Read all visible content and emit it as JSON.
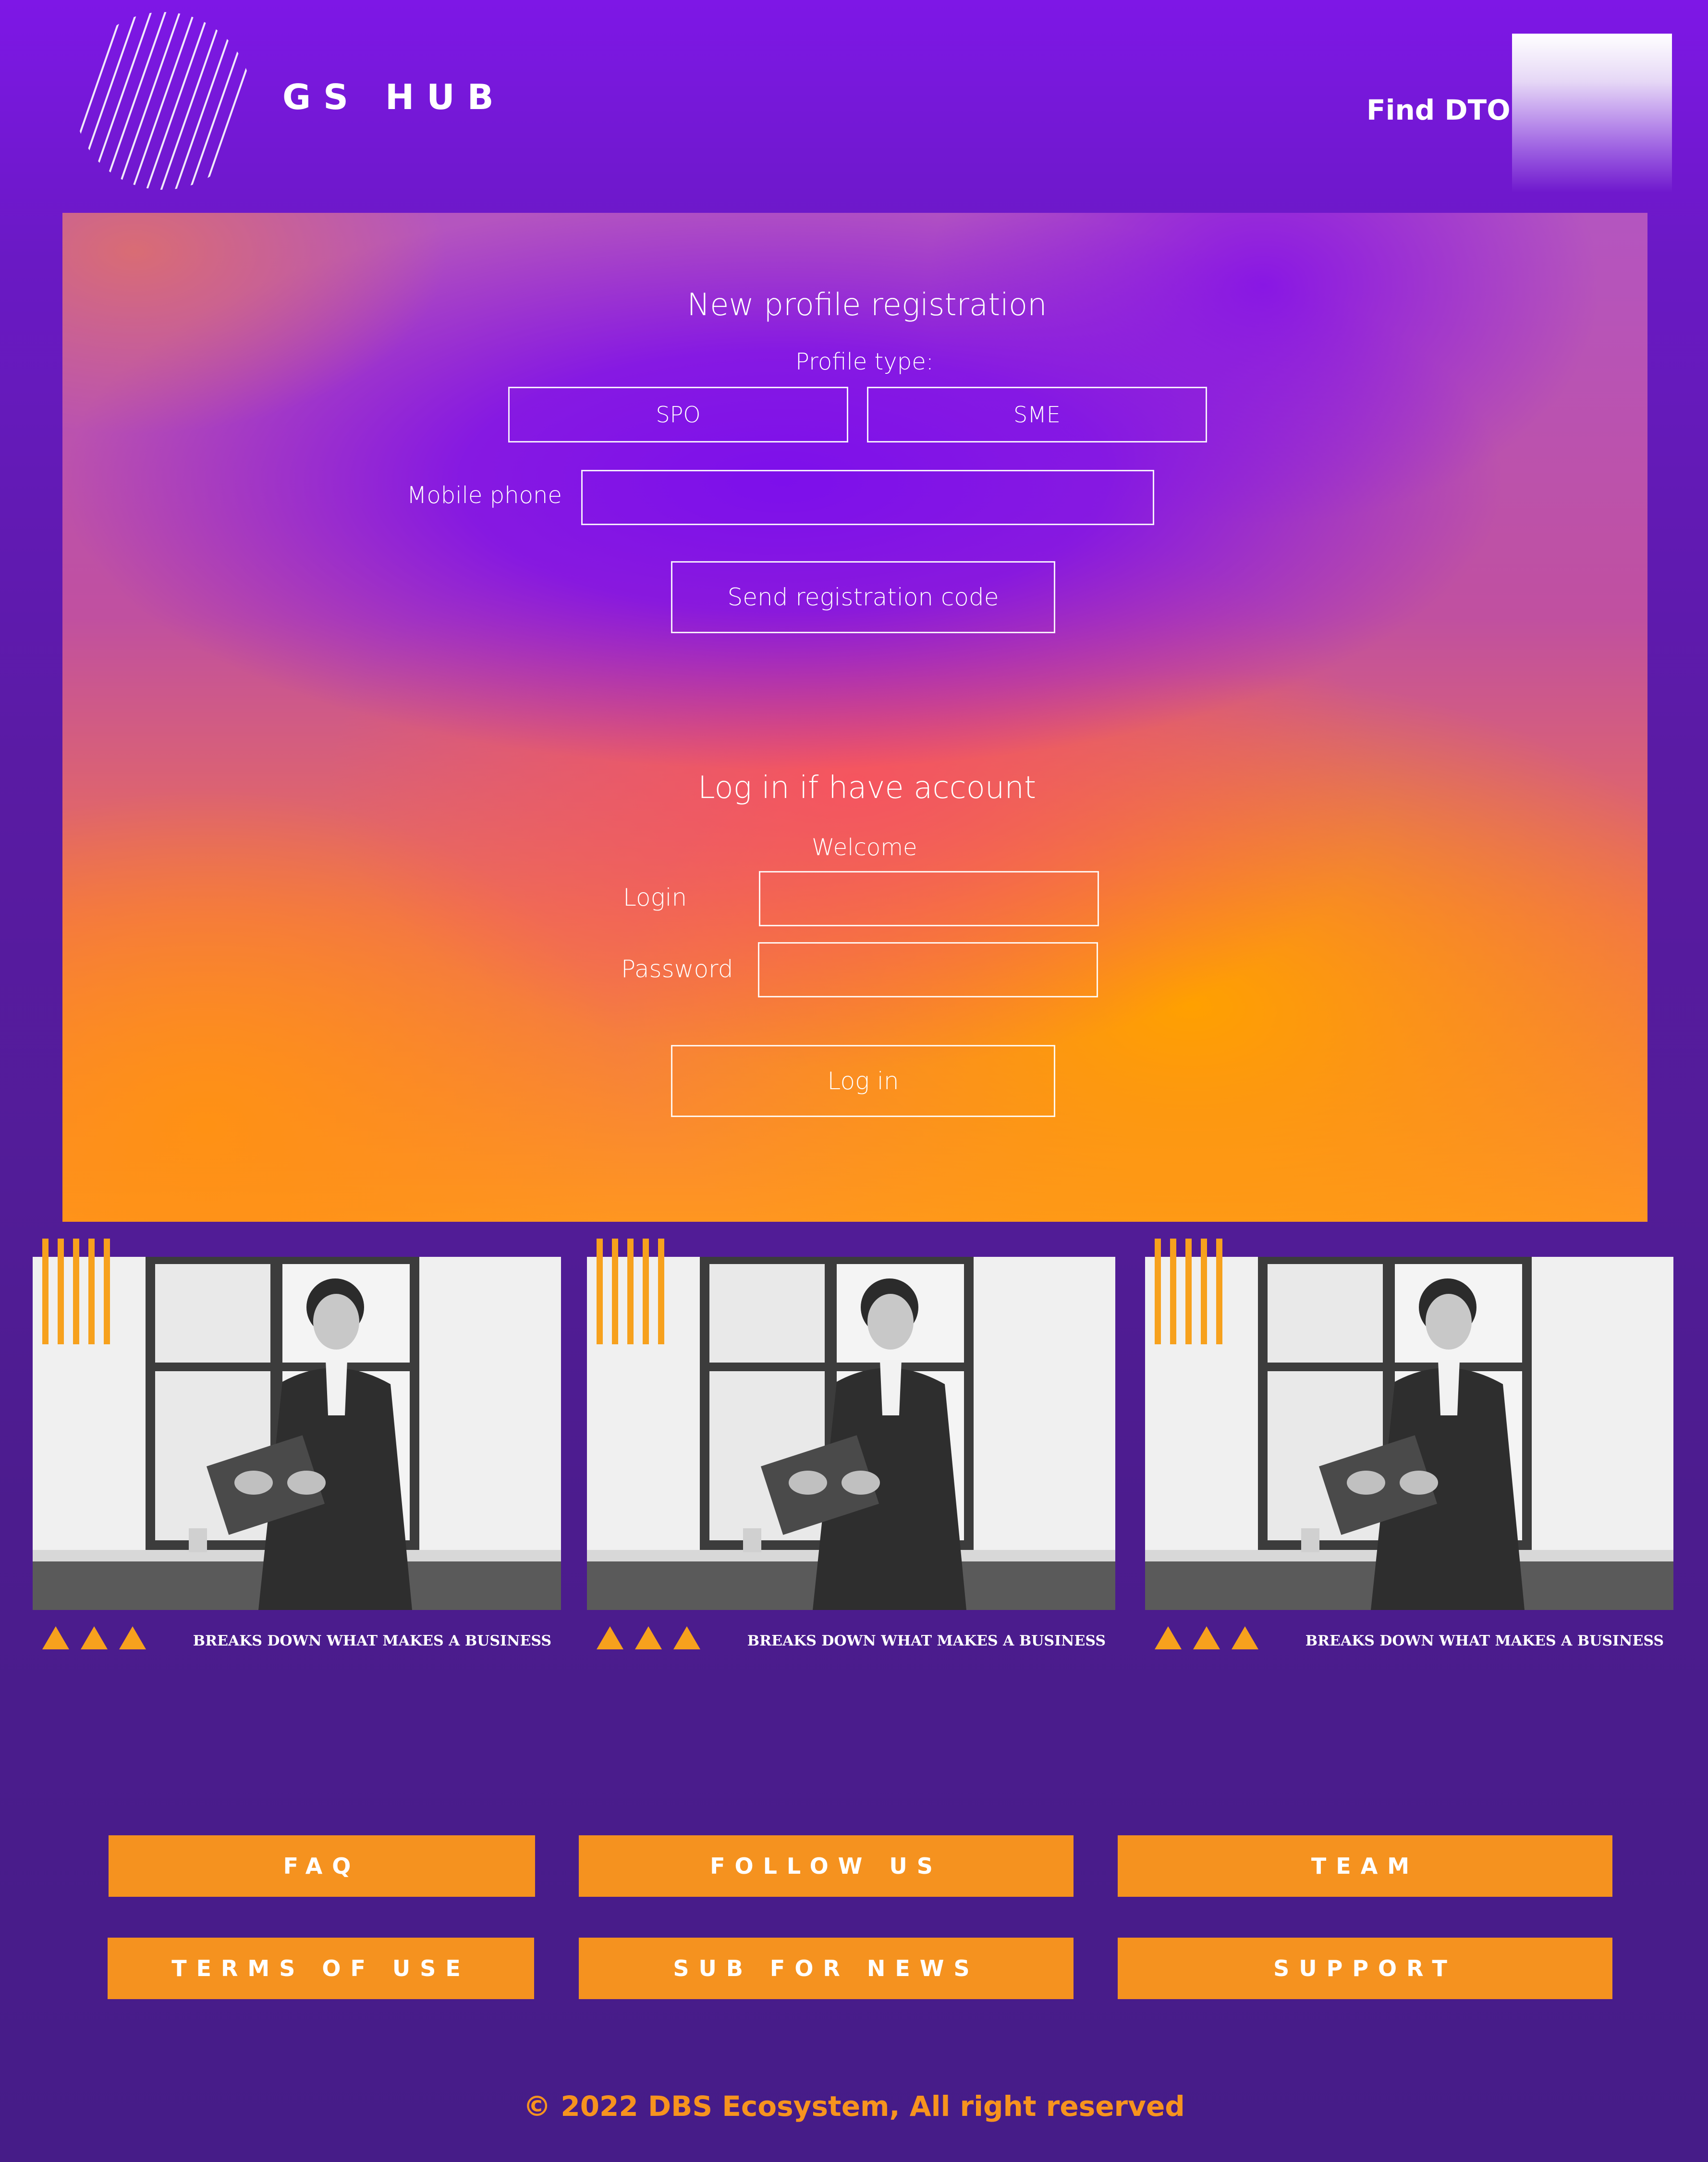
{
  "header": {
    "brand": "GS HUB",
    "nav_find_dto": "Find DTO"
  },
  "registration": {
    "title": "New profile registration",
    "profile_type_label": "Profile type:",
    "profile_types": [
      "SPO",
      "SME"
    ],
    "mobile_phone_label": "Mobile phone",
    "mobile_phone_value": "",
    "send_code_label": "Send registration code"
  },
  "login": {
    "title": "Log in if have account",
    "welcome": "Welcome",
    "login_label": "Login",
    "login_value": "",
    "password_label": "Password",
    "password_value": "",
    "submit_label": "Log in"
  },
  "cards": [
    {
      "caption": "BREAKS DOWN WHAT MAKES A BUSINESS"
    },
    {
      "caption": "BREAKS DOWN WHAT MAKES A BUSINESS"
    },
    {
      "caption": "BREAKS DOWN WHAT MAKES A BUSINESS"
    }
  ],
  "footer": {
    "links": [
      "FAQ",
      "FOLLOW US",
      "TEAM",
      "TERMS OF USE",
      "SUB FOR NEWS",
      "SUPPORT"
    ],
    "copyright": "© 2022 DBS Ecosystem, All right reserved"
  },
  "colors": {
    "accent_orange": "#f5921f",
    "background_purple": "#5a1ba4",
    "hero_violet": "#7d0feb"
  }
}
